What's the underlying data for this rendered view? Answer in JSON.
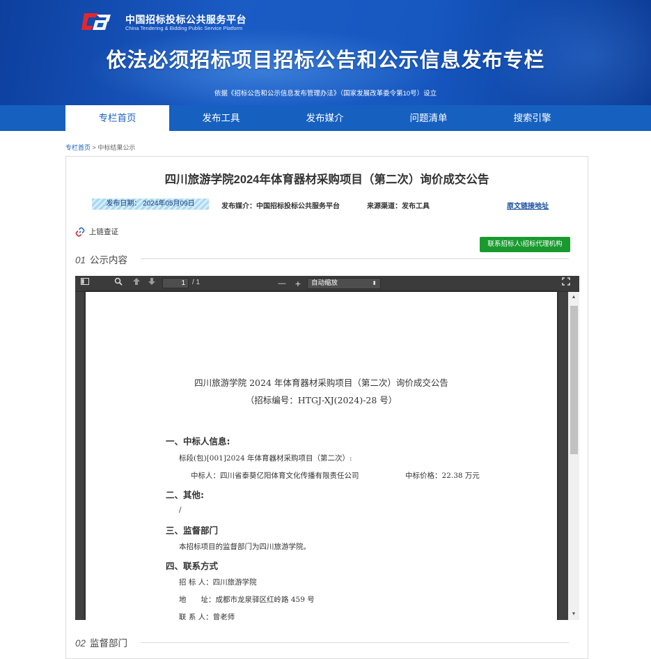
{
  "header": {
    "logo_cn": "中国招标投标公共服务平台",
    "logo_en": "China Tendering & Bidding Public Service Platform",
    "title": "依法必须招标项目招标公告和公示信息发布专栏",
    "basis": "依据《招标公告和公示信息发布管理办法》（国家发展改革委令第10号）设立"
  },
  "nav": {
    "items": [
      {
        "label": "专栏首页",
        "active": true
      },
      {
        "label": "发布工具",
        "active": false
      },
      {
        "label": "发布媒介",
        "active": false
      },
      {
        "label": "问题清单",
        "active": false
      },
      {
        "label": "搜索引擎",
        "active": false
      }
    ]
  },
  "breadcrumb": {
    "home": "专栏首页",
    "sep": ">",
    "current": "中标结果公示"
  },
  "notice": {
    "title": "四川旅游学院2024年体育器材采购项目（第二次）询价成交公告",
    "publish_date": "发布日期： 2024年05月09日",
    "publish_media_label": "发布媒介：",
    "publish_media": "中国招标投标公共服务平台",
    "source_label": "来源渠道：",
    "source": "发布工具",
    "original_link": "原文链接地址",
    "chain_verify": "上链查证",
    "contact_button": "联系招标人\\招标代理机构"
  },
  "sections": [
    {
      "num": "01",
      "label": "公示内容"
    },
    {
      "num": "02",
      "label": "监督部门"
    }
  ],
  "viewer": {
    "page_current": "1",
    "page_total": "/ 1",
    "zoom_minus": "—",
    "zoom_plus": "+",
    "zoom_value": "自动缩放",
    "doc": {
      "title": "四川旅游学院 2024 年体育器材采购项目（第二次）询价成交公告",
      "code": "（招标编号：HTGJ-XJ(2024)-28 号）",
      "h1": "一、中标人信息:",
      "lot": "标段(包)[001]2024 年体育器材采购项目（第二次）:",
      "winner": "中标人：四川省泰葵亿阳体育文化传播有限责任公司",
      "price": "中标价格：22.38 万元",
      "h2": "二、其他:",
      "other": "/",
      "h3": "三、监督部门",
      "supervise": "本招标项目的监督部门为四川旅游学院。",
      "h4": "四、联系方式",
      "tenderer": "招 标 人：四川旅游学院",
      "address": "地　　址：成都市龙泉驿区红岭路 459 号",
      "contact": "联 系 人：曾老师"
    }
  }
}
